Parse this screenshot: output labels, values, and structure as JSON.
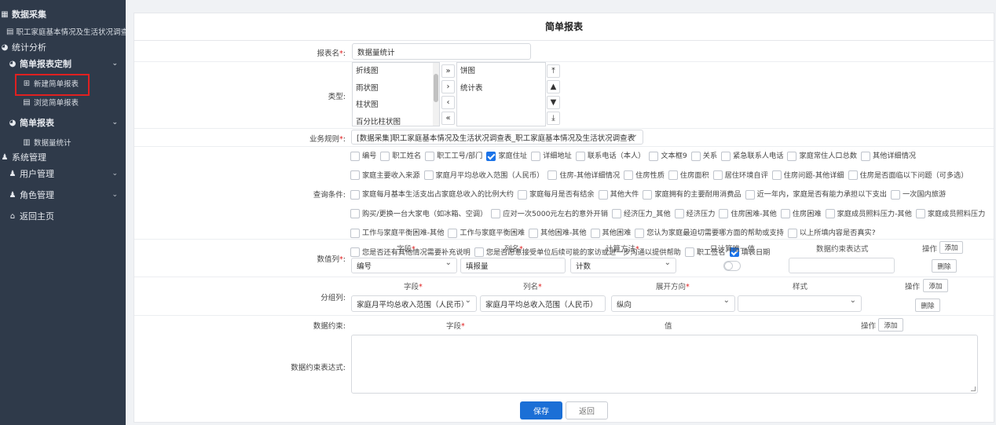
{
  "sidebar": {
    "items": [
      {
        "label": "数据采集",
        "icon": "table-icon"
      },
      {
        "label": "职工家庭基本情况及生活状况调查表",
        "icon": "document-icon"
      },
      {
        "label": "统计分析",
        "icon": "pie-chart-icon"
      },
      {
        "label": "简单报表定制",
        "icon": "pie-chart-icon"
      },
      {
        "label": "新建简单报表",
        "icon": "plus-square-icon"
      },
      {
        "label": "浏览简单报表",
        "icon": "list-icon"
      },
      {
        "label": "简单报表",
        "icon": "pie-chart-icon"
      },
      {
        "label": "数据量统计",
        "icon": "bar-chart-icon"
      },
      {
        "label": "系统管理",
        "icon": "users-icon"
      },
      {
        "label": "用户管理",
        "icon": "user-cog-icon"
      },
      {
        "label": "角色管理",
        "icon": "user-cog-icon"
      },
      {
        "label": "返回主页",
        "icon": "home-icon"
      }
    ]
  },
  "form": {
    "title": "简单报表",
    "report_name": {
      "label": "报表名",
      "value": "数据量统计"
    },
    "type": {
      "label": "类型",
      "available": [
        "折线图",
        "雨状图",
        "柱状图",
        "百分比柱状图"
      ],
      "selected": [
        "饼图",
        "统计表"
      ],
      "move_buttons": [
        "»",
        "›",
        "‹",
        "«"
      ],
      "order_buttons": [
        "⤒",
        "▲",
        "▼",
        "⤓"
      ]
    },
    "business_rule": {
      "label": "业务规则",
      "value": "[数据采集]职工家庭基本情况及生活状况调查表_职工家庭基本情况及生活状况调查表"
    },
    "query_conditions": {
      "label": "查询条件",
      "options": [
        {
          "text": "编号",
          "checked": false
        },
        {
          "text": "职工姓名",
          "checked": false
        },
        {
          "text": "职工工号/部门",
          "checked": false
        },
        {
          "text": "家庭住址",
          "checked": true
        },
        {
          "text": "详细地址",
          "checked": false
        },
        {
          "text": "联系电话（本人）",
          "checked": false
        },
        {
          "text": "文本框9",
          "checked": false
        },
        {
          "text": "关系",
          "checked": false
        },
        {
          "text": "紧急联系人电话",
          "checked": false
        },
        {
          "text": "家庭常住人口总数",
          "checked": false
        },
        {
          "text": "其他详细情况",
          "checked": false
        },
        {
          "text": "家庭主要收入来源",
          "checked": false
        },
        {
          "text": "家庭月平均总收入范围（人民币）",
          "checked": false
        },
        {
          "text": "住房-其他详细情况",
          "checked": false
        },
        {
          "text": "住房性质",
          "checked": false
        },
        {
          "text": "住房面积",
          "checked": false
        },
        {
          "text": "居住环境自评",
          "checked": false
        },
        {
          "text": "住房问题-其他详细",
          "checked": false
        },
        {
          "text": "住房是否面临以下问题（可多选）",
          "checked": false
        },
        {
          "text": "家庭每月基本生活支出占家庭总收入的比例大约",
          "checked": false
        },
        {
          "text": "家庭每月是否有结余",
          "checked": false
        },
        {
          "text": "其他大件",
          "checked": false
        },
        {
          "text": "家庭拥有的主要耐用消费品",
          "checked": false
        },
        {
          "text": "近一年内，家庭是否有能力承担以下支出",
          "checked": false
        },
        {
          "text": "一次国内旅游",
          "checked": false
        },
        {
          "text": "购买/更换一台大家电（如冰箱、空调）",
          "checked": false
        },
        {
          "text": "应对一次5000元左右的意外开销",
          "checked": false
        },
        {
          "text": "经济压力_其他",
          "checked": false
        },
        {
          "text": "经济压力",
          "checked": false
        },
        {
          "text": "住房困难-其他",
          "checked": false
        },
        {
          "text": "住房困难",
          "checked": false
        },
        {
          "text": "家庭成员照料压力-其他",
          "checked": false
        },
        {
          "text": "家庭成员照料压力",
          "checked": false
        },
        {
          "text": "工作与家庭平衡困难-其他",
          "checked": false
        },
        {
          "text": "工作与家庭平衡困难",
          "checked": false
        },
        {
          "text": "其他困难-其他",
          "checked": false
        },
        {
          "text": "其他困难",
          "checked": false
        },
        {
          "text": "您认为家庭最迫切需要哪方面的帮助或支持",
          "checked": false
        },
        {
          "text": "以上所填内容是否真实?",
          "checked": false
        },
        {
          "text": "您是否还有其他情况需要补充说明",
          "checked": false
        },
        {
          "text": "您是否愿意接受单位后续可能的家访或进一步沟通以提供帮助",
          "checked": false
        },
        {
          "text": "职工签名",
          "checked": false
        },
        {
          "text": "填表日期",
          "checked": true
        }
      ]
    },
    "data_columns": {
      "label": "数值列",
      "headers": {
        "field": "字段",
        "column_name": "列名",
        "method": "计算方法",
        "unique": "只计算唯一值",
        "constraint": "数据约束表达式",
        "action": "操作"
      },
      "add_label": "添加",
      "row": {
        "field": "编号",
        "column_name": "填报量",
        "method": "计数",
        "unique": false,
        "constraint": "",
        "delete_label": "删除"
      }
    },
    "group_columns": {
      "label": "分组列",
      "headers": {
        "field": "字段",
        "column_name": "列名",
        "direction": "展开方向",
        "style": "样式",
        "action": "操作"
      },
      "add_label": "添加",
      "row": {
        "field": "家庭月平均总收入范围（人民币）",
        "column_name": "家庭月平均总收入范围（人民币）",
        "direction": "纵向",
        "style": "",
        "delete_label": "删除"
      }
    },
    "data_constraints": {
      "label": "数据约束",
      "headers": {
        "field": "字段",
        "value": "值",
        "action": "操作"
      },
      "add_label": "添加"
    },
    "constraint_expression": {
      "label": "数据约束表达式",
      "value": ""
    },
    "buttons": {
      "save": "保存",
      "back": "返回"
    }
  },
  "colors": {
    "sidebar_bg": "#2f3a4a",
    "primary": "#1b6fd6",
    "required": "#e02020"
  }
}
